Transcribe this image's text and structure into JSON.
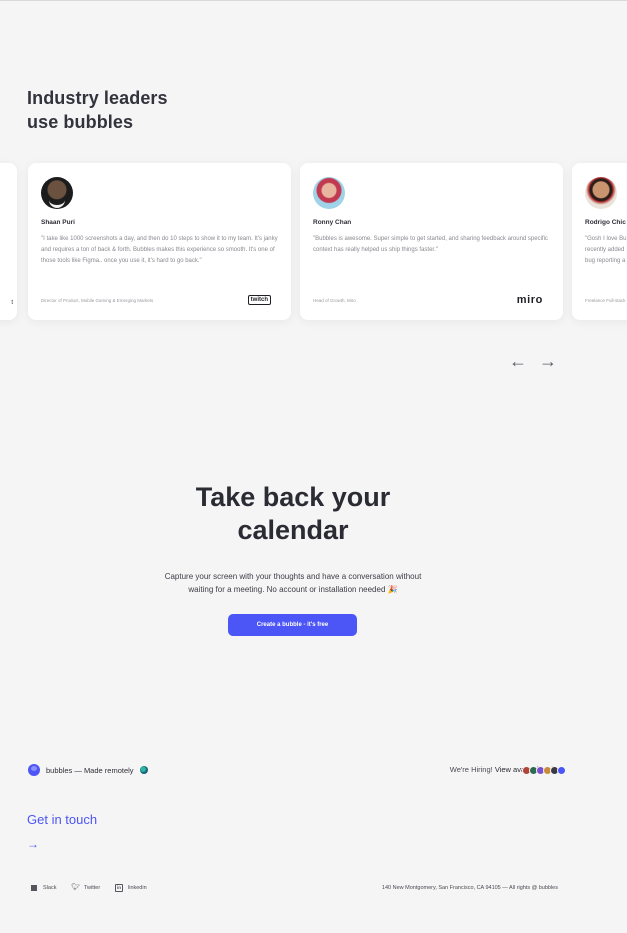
{
  "testimonials_section": {
    "heading_line1": "Industry leaders",
    "heading_line2": "use bubbles",
    "cards": [
      {
        "name": "",
        "quote": "",
        "role": "",
        "company_logo": "t"
      },
      {
        "name": "Shaan Puri",
        "quote": "\"I take like 1000 screenshots a day, and then do 10 steps to show it to my team. It's janky and requires a ton of back & forth. Bubbles makes this experience so smooth. It's one of those tools like Figma.. once you use it, it's hard to go back.\"",
        "role": "Director of Product, Mobile Gaming & Emerging Markets",
        "company_logo": "twitch"
      },
      {
        "name": "Ronny Chan",
        "quote": "\"Bubbles is awesome. Super simple to get started, and sharing feedback around specific context has really helped us ship things faster.\"",
        "role": "Head of Growth, Miro",
        "company_logo": "miro"
      },
      {
        "name": "Rodrigo Chic",
        "quote": "\"Gosh I love Bu recently added bug reporting a",
        "role": "Freelance Full-stack",
        "company_logo": ""
      }
    ],
    "prev_arrow": "←",
    "next_arrow": "→"
  },
  "cta": {
    "title_line1": "Take back your",
    "title_line2": "calendar",
    "subtitle_line1": "Capture your screen with your thoughts and have a conversation without",
    "subtitle_line2": "waiting for a meeting. No account or installation needed 🎉",
    "button_label": "Create a bubble - it's free",
    "accent_color": "#4c55f5"
  },
  "footer": {
    "brand_text": "bubbles — Made remotely",
    "hiring_text": "We're Hiring!",
    "hiring_link": "View available roles",
    "team_avatar_colors": [
      "#b0433a",
      "#2d6b4f",
      "#7a4fd0",
      "#c98a3b",
      "#3a3a44",
      "#4c55f5"
    ],
    "get_in_touch": "Get in touch",
    "get_in_touch_arrow": "→",
    "socials": [
      {
        "label": "Slack",
        "icon": "slack-icon"
      },
      {
        "label": "Twitter",
        "icon": "twitter-icon"
      },
      {
        "label": "linkedin",
        "icon": "linkedin-icon"
      }
    ],
    "address": "140 New Montgomery, San Francisco, CA 94105  —   All rights @ bubbles"
  }
}
